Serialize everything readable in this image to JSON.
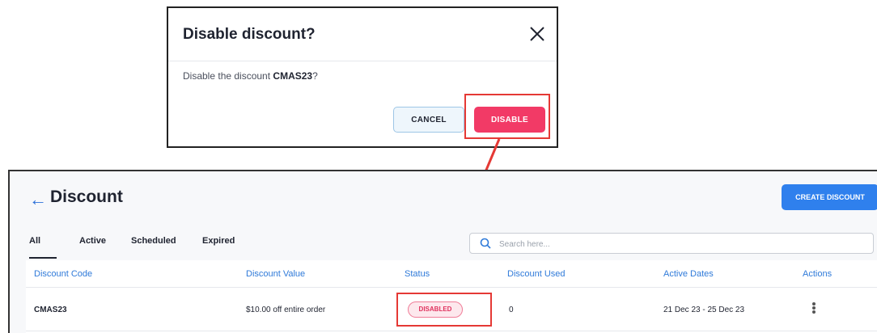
{
  "modal": {
    "title": "Disable discount?",
    "body_prefix": "Disable the discount ",
    "body_code": "CMAS23",
    "body_suffix": "?",
    "cancel_label": "CANCEL",
    "disable_label": "DISABLE"
  },
  "page": {
    "title": "Discount",
    "create_label": "CREATE DISCOUNT"
  },
  "tabs": [
    {
      "label": "All"
    },
    {
      "label": "Active"
    },
    {
      "label": "Scheduled"
    },
    {
      "label": "Expired"
    }
  ],
  "search": {
    "placeholder": "Search here..."
  },
  "table": {
    "headers": [
      "Discount Code",
      "Discount Value",
      "Status",
      "Discount Used",
      "Active Dates",
      "Actions"
    ],
    "rows": [
      {
        "code": "CMAS23",
        "value": "$10.00 off entire order",
        "status": "DISABLED",
        "used": "0",
        "dates": "21 Dec 23 - 25 Dec 23"
      }
    ]
  },
  "colors": {
    "accent_blue": "#2f80ed",
    "danger_pink": "#f23a66",
    "highlight_red": "#e53935"
  }
}
